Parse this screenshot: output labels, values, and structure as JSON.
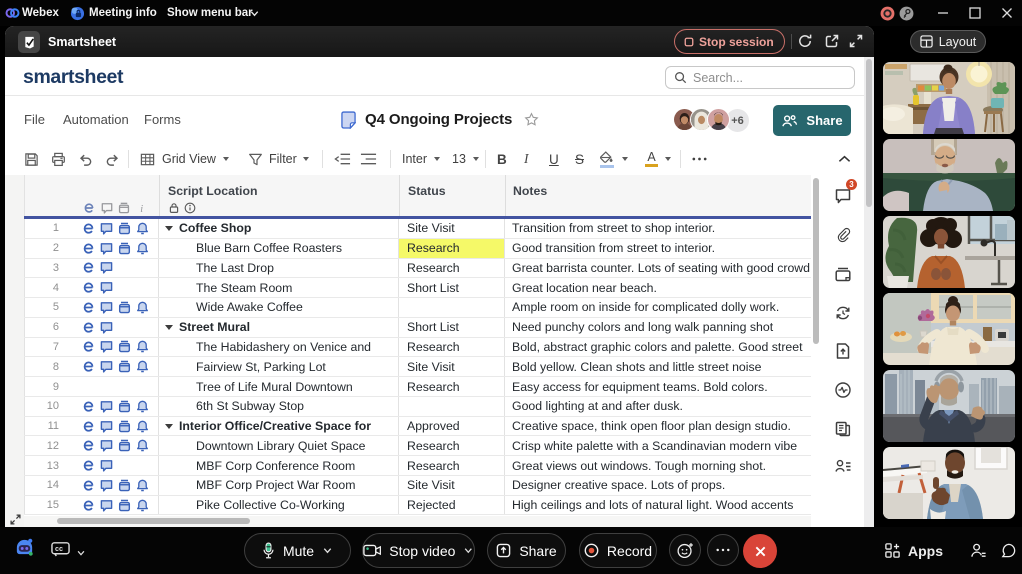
{
  "os_bar": {
    "brand": "Webex",
    "meeting_info": "Meeting info",
    "show_menu_bar": "Show menu bar"
  },
  "app_titlebar": {
    "app_name": "Smartsheet",
    "stop_session": "Stop session"
  },
  "smartsheet": {
    "logo": "smartsheet",
    "search_placeholder": "Search...",
    "menus": [
      "File",
      "Automation",
      "Forms"
    ],
    "sheet_title": "Q4 Ongoing Projects",
    "collaborators_overflow": "+6",
    "share_label": "Share",
    "toolbar": {
      "view_label": "Grid View",
      "filter_label": "Filter",
      "font_label": "Inter",
      "font_size": "13",
      "bold": "B",
      "italic": "I",
      "underline": "U",
      "strike": "S",
      "more": "..."
    },
    "grid": {
      "columns": {
        "primary": "Script Location",
        "status": "Status",
        "notes": "Notes"
      },
      "rows": [
        {
          "num": 1,
          "parent": true,
          "name": "Coffee Shop",
          "status": "Site Visit",
          "highlight": false,
          "icons": [
            "clip",
            "comment",
            "box",
            "bell"
          ],
          "notes": "Transition from street to shop interior."
        },
        {
          "num": 2,
          "parent": false,
          "name": "Blue Barn Coffee Roasters",
          "status": "Research",
          "highlight": true,
          "icons": [
            "clip",
            "comment",
            "box",
            "bell"
          ],
          "notes": "Good transition from street to interior."
        },
        {
          "num": 3,
          "parent": false,
          "name": "The Last Drop",
          "status": "Research",
          "highlight": false,
          "icons": [
            "clip",
            "comment"
          ],
          "notes": "Great barrista counter. Lots of seating with good crowd"
        },
        {
          "num": 4,
          "parent": false,
          "name": "The Steam Room",
          "status": "Short List",
          "highlight": false,
          "icons": [
            "clip",
            "comment"
          ],
          "notes": "Great location near beach."
        },
        {
          "num": 5,
          "parent": false,
          "name": "Wide Awake Coffee",
          "status": "",
          "highlight": false,
          "icons": [
            "clip",
            "comment",
            "box",
            "bell"
          ],
          "notes": "Ample room on inside for complicated dolly work."
        },
        {
          "num": 6,
          "parent": true,
          "name": "Street Mural",
          "status": "Short List",
          "highlight": false,
          "icons": [
            "clip",
            "comment"
          ],
          "notes": "Need punchy colors and long walk panning shot"
        },
        {
          "num": 7,
          "parent": false,
          "name": "The Habidashery on Venice and",
          "status": "Research",
          "highlight": false,
          "icons": [
            "clip",
            "comment",
            "box",
            "bell"
          ],
          "notes": "Bold, abstract graphic colors and palette. Good street"
        },
        {
          "num": 8,
          "parent": false,
          "name": "Fairview St, Parking Lot",
          "status": "Site Visit",
          "highlight": false,
          "icons": [
            "clip",
            "comment",
            "box",
            "bell"
          ],
          "notes": "Bold yellow. Clean shots and little street noise"
        },
        {
          "num": 9,
          "parent": false,
          "name": "Tree of Life Mural Downtown",
          "status": "Research",
          "highlight": false,
          "icons": [],
          "notes": "Easy access for equipment teams. Bold colors."
        },
        {
          "num": 10,
          "parent": false,
          "name": "6th St Subway Stop",
          "status": "",
          "highlight": false,
          "icons": [
            "clip",
            "comment",
            "box",
            "bell"
          ],
          "notes": "Good lighting at and after dusk."
        },
        {
          "num": 11,
          "parent": true,
          "name": "Interior Office/Creative Space for",
          "status": "Approved",
          "highlight": false,
          "icons": [
            "clip",
            "comment",
            "box",
            "bell"
          ],
          "notes": "Creative space, think open floor plan design studio."
        },
        {
          "num": 12,
          "parent": false,
          "name": "Downtown Library Quiet Space",
          "status": "Research",
          "highlight": false,
          "icons": [
            "clip",
            "comment",
            "box",
            "bell"
          ],
          "notes": "Crisp white palette with a Scandinavian modern vibe"
        },
        {
          "num": 13,
          "parent": false,
          "name": "MBF Corp Conference Room",
          "status": "Research",
          "highlight": false,
          "icons": [
            "clip",
            "comment"
          ],
          "notes": "Great views out windows. Tough morning shot."
        },
        {
          "num": 14,
          "parent": false,
          "name": "MBF Corp Project War Room",
          "status": "Site Visit",
          "highlight": false,
          "icons": [
            "clip",
            "comment",
            "box",
            "bell"
          ],
          "notes": "Designer creative space. Lots of props."
        },
        {
          "num": 15,
          "parent": false,
          "name": "Pike Collective Co-Working",
          "status": "Rejected",
          "highlight": false,
          "icons": [
            "clip",
            "comment",
            "box",
            "bell"
          ],
          "notes": "High ceilings and lots of natural light. Wood accents"
        }
      ]
    },
    "right_rail": {
      "badge": "3",
      "items": [
        "conversations",
        "attachments",
        "proofs",
        "update-requests",
        "publish",
        "activity-log",
        "copy-sheet",
        "contacts"
      ]
    },
    "status_highlight_color": "#f5f968",
    "share_button_color": "#27666d"
  },
  "video_panel": {
    "layout_label": "Layout",
    "participants": [
      {
        "id": "p1",
        "description": "woman in purple cardigan, beige living room"
      },
      {
        "id": "p2",
        "description": "older man in tan shirt, dark green sofa"
      },
      {
        "id": "p3",
        "description": "woman with curly hair, rust top, dark kitchen"
      },
      {
        "id": "p4",
        "description": "woman in cream blouse gesturing, bright kitchen"
      },
      {
        "id": "p5",
        "description": "older man in suit waving, city skyline"
      },
      {
        "id": "p6",
        "description": "man in denim shirt, thumbs up, white office"
      }
    ]
  },
  "control_bar": {
    "mute": "Mute",
    "stop_video": "Stop video",
    "share": "Share",
    "record": "Record",
    "apps": "Apps"
  }
}
